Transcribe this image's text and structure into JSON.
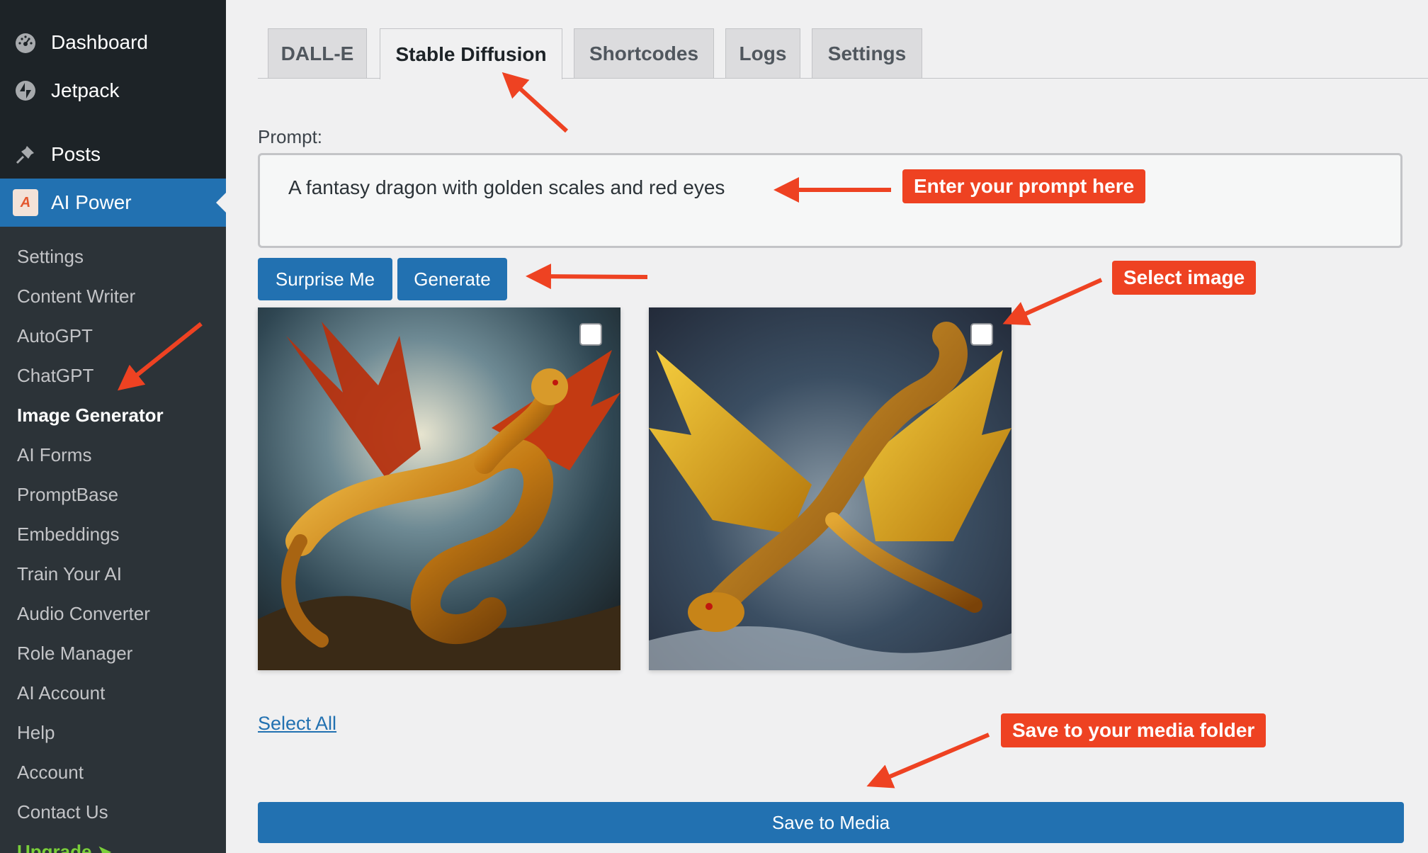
{
  "sidebar": {
    "top_items": [
      {
        "label": "Dashboard",
        "icon": "dashboard-icon"
      },
      {
        "label": "Jetpack",
        "icon": "jetpack-icon"
      },
      {
        "label": "Posts",
        "icon": "pin-icon"
      }
    ],
    "active_item": {
      "label": "AI Power",
      "icon": "ai-power-logo-icon"
    },
    "submenu": [
      "Settings",
      "Content Writer",
      "AutoGPT",
      "ChatGPT",
      "Image Generator",
      "AI Forms",
      "PromptBase",
      "Embeddings",
      "Train Your AI",
      "Audio Converter",
      "Role Manager",
      "AI Account",
      "Help",
      "Account",
      "Contact Us",
      "Upgrade ➤"
    ],
    "current_submenu": "Image Generator"
  },
  "tabs": [
    "DALL-E",
    "Stable Diffusion",
    "Shortcodes",
    "Logs",
    "Settings"
  ],
  "active_tab": "Stable Diffusion",
  "prompt": {
    "label": "Prompt:",
    "value": "A fantasy dragon with golden scales and red eyes"
  },
  "buttons": {
    "surprise": "Surprise Me",
    "generate": "Generate",
    "select_all": "Select All",
    "save_media": "Save to Media"
  },
  "images": [
    {
      "name": "generated-image-1",
      "selected": false
    },
    {
      "name": "generated-image-2",
      "selected": false
    }
  ],
  "annotations": {
    "prompt": "Enter your prompt here",
    "select": "Select image",
    "save": "Save to your media folder"
  },
  "colors": {
    "accent": "#2271b1",
    "sidebar": "#2c3338",
    "annotation": "#ee4222"
  }
}
